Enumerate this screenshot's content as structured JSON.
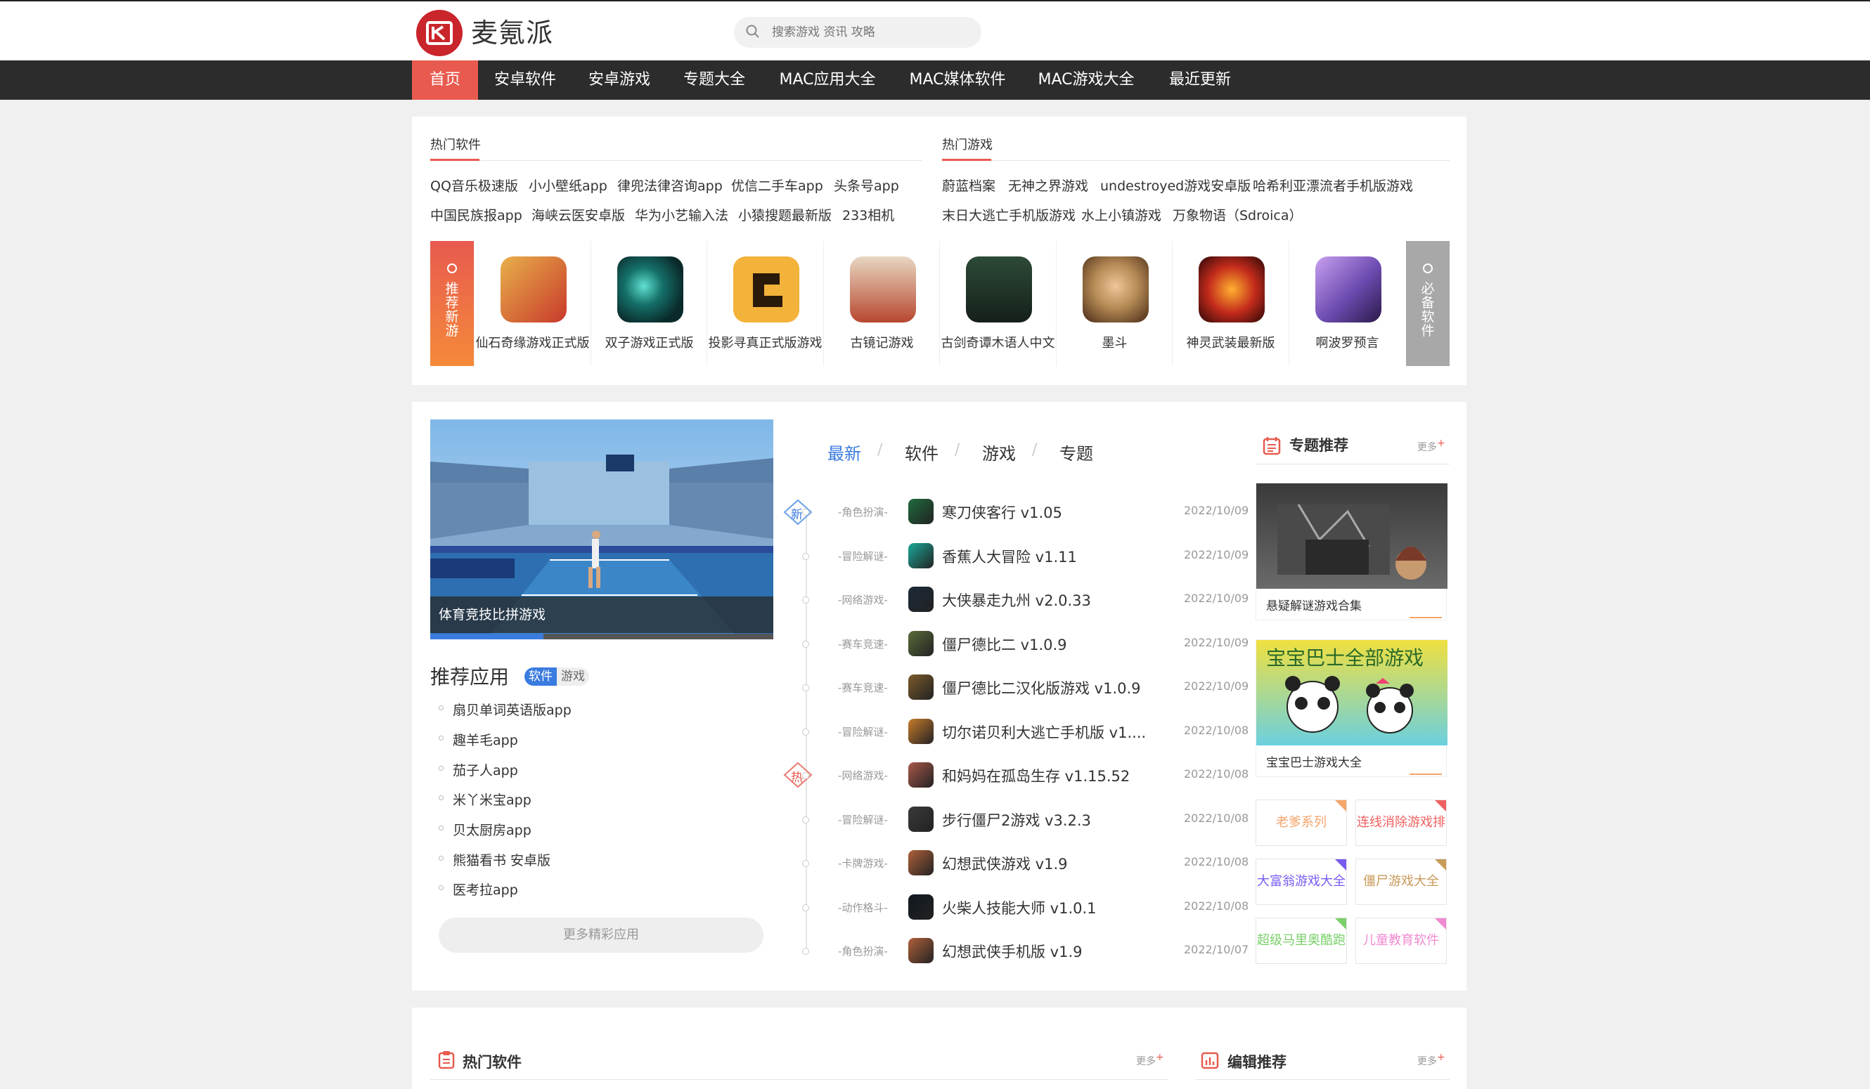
{
  "site": {
    "name": "麦氪派",
    "search_placeholder": "搜索游戏 资讯 攻略"
  },
  "nav": [
    "首页",
    "安卓软件",
    "安卓游戏",
    "专题大全",
    "MAC应用大全",
    "MAC媒体软件",
    "MAC游戏大全",
    "最近更新"
  ],
  "hot_software": {
    "title": "热门软件",
    "row1": [
      "QQ音乐极速版",
      "小小壁纸app",
      "律兜法律咨询app",
      "优信二手车app",
      "头条号app"
    ],
    "row2": [
      "中国民族报app",
      "海峡云医安卓版",
      "华为小艺输入法",
      "小猿搜题最新版",
      "233相机"
    ]
  },
  "hot_games": {
    "title": "热门游戏",
    "row1": [
      "蔚蓝档案",
      "无神之界游戏",
      "undestroyed游戏安卓版",
      "哈希利亚漂流者手机版游戏"
    ],
    "row2": [
      "末日大逃亡手机版游戏",
      "水上小镇游戏",
      "万象物语（Sdroica）"
    ]
  },
  "recommend_new": {
    "left_label": "推荐新游",
    "right_label": "必备软件",
    "apps": [
      {
        "name": "仙石奇缘游戏正式版",
        "icon": "xianshi-icon",
        "color": "#c8392b"
      },
      {
        "name": "双子游戏正式版",
        "icon": "twins-icon",
        "color": "#0e3b3a"
      },
      {
        "name": "投影寻真正式版游戏",
        "icon": "shadow-icon",
        "color": "#f3b23a"
      },
      {
        "name": "古镜记游戏",
        "icon": "mirror-icon",
        "color": "#d2b79a"
      },
      {
        "name": "古剑奇谭木语人中文",
        "icon": "sword-icon",
        "color": "#233a2e"
      },
      {
        "name": "墨斗",
        "icon": "mouk-icon",
        "color": "#b58a55"
      },
      {
        "name": "神灵武装最新版",
        "icon": "armor-icon",
        "color": "#c32b1b"
      },
      {
        "name": "啊波罗预言",
        "icon": "apollo-icon",
        "color": "#6c4bb0"
      }
    ]
  },
  "banner": {
    "caption": "体育竞技比拼游戏",
    "progress": 0.33
  },
  "recommend_apps": {
    "title": "推荐应用",
    "tab_software": "软件",
    "tab_games": "游戏",
    "items": [
      "扇贝单词英语版app",
      "趣羊毛app",
      "茄子人app",
      "米丫米宝app",
      "贝太厨房app",
      "熊猫看书 安卓版",
      "医考拉app"
    ],
    "more": "更多精彩应用"
  },
  "feed": {
    "tabs": [
      "最新",
      "软件",
      "游戏",
      "专题"
    ],
    "new_badge": "新",
    "hot_badge": "热",
    "items": [
      {
        "cat": "-角色扮演-",
        "name": "寒刀侠客行 v1.05",
        "date": "2022/10/09",
        "color": "#1f6b3e"
      },
      {
        "cat": "-冒险解谜-",
        "name": "香蕉人大冒险 v1.11",
        "date": "2022/10/09",
        "color": "#1aa89a"
      },
      {
        "cat": "-网络游戏-",
        "name": "大侠暴走九州 v2.0.33",
        "date": "2022/10/09",
        "color": "#1b2a3a"
      },
      {
        "cat": "-赛车竞速-",
        "name": "僵尸德比二 v1.0.9",
        "date": "2022/10/09",
        "color": "#5a6b3a"
      },
      {
        "cat": "-赛车竞速-",
        "name": "僵尸德比二汉化版游戏 v1.0.9",
        "date": "2022/10/09",
        "color": "#7a5a2a"
      },
      {
        "cat": "-冒险解谜-",
        "name": "切尔诺贝利大逃亡手机版 v1....",
        "date": "2022/10/08",
        "color": "#c77b2b"
      },
      {
        "cat": "-网络游戏-",
        "name": "和妈妈在孤岛生存 v1.15.52",
        "date": "2022/10/08",
        "color": "#a8584a"
      },
      {
        "cat": "-冒险解谜-",
        "name": "步行僵尸2游戏 v3.2.3",
        "date": "2022/10/08",
        "color": "#3a3a3a"
      },
      {
        "cat": "-卡牌游戏-",
        "name": "幻想武侠游戏 v1.9",
        "date": "2022/10/08",
        "color": "#b0603a"
      },
      {
        "cat": "-动作格斗-",
        "name": "火柴人技能大师 v1.0.1",
        "date": "2022/10/08",
        "color": "#101820"
      },
      {
        "cat": "-角色扮演-",
        "name": "幻想武侠手机版 v1.9",
        "date": "2022/10/07",
        "color": "#b0603a"
      }
    ]
  },
  "topics": {
    "title": "专题推荐",
    "more": "更多",
    "cards": [
      {
        "caption": "悬疑解谜游戏合集"
      },
      {
        "caption": "宝宝巴士游戏大全",
        "art_text": "宝宝巴士全部游戏"
      }
    ],
    "tags": [
      {
        "label": "老爹系列",
        "color": "#f5a46a"
      },
      {
        "label": "连线消除游戏排",
        "color": "#f06060"
      },
      {
        "label": "大富翁游戏大全",
        "color": "#7a5af0"
      },
      {
        "label": "僵尸游戏大全",
        "color": "#c89a5a"
      },
      {
        "label": "超级马里奥酷跑",
        "color": "#7ad06a"
      },
      {
        "label": "儿童教育软件",
        "color": "#f08ad0"
      }
    ]
  },
  "bottom": {
    "left_title": "热门软件",
    "right_title": "编辑推荐",
    "more": "更多"
  }
}
